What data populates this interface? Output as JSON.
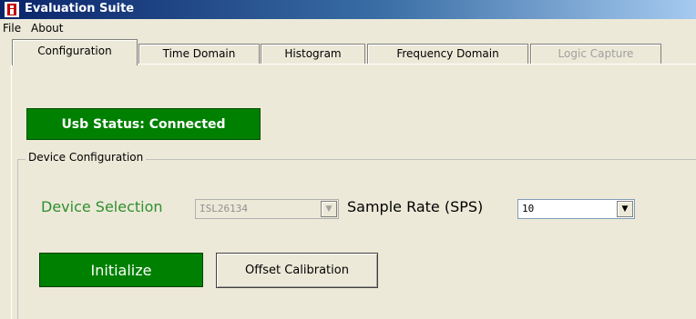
{
  "window": {
    "title": "Evaluation Suite",
    "icon": "i-logo-icon"
  },
  "menu": {
    "items": [
      "File",
      "About"
    ]
  },
  "tabs": [
    {
      "label": "Configuration",
      "active": true
    },
    {
      "label": "Time Domain"
    },
    {
      "label": "Histogram"
    },
    {
      "label": "Frequency Domain"
    },
    {
      "label": "Logic Capture",
      "disabled": true
    }
  ],
  "usb_status": {
    "label": "Usb Status: Connected",
    "color": "#008000"
  },
  "device_config": {
    "group_label": "Device Configuration",
    "device_selection_label": "Device Selection",
    "device_selection_value": "ISL26134",
    "sample_rate_label": "Sample Rate (SPS)",
    "sample_rate_value": "10"
  },
  "buttons": {
    "initialize": "Initialize",
    "offset_calibration": "Offset Calibration"
  }
}
